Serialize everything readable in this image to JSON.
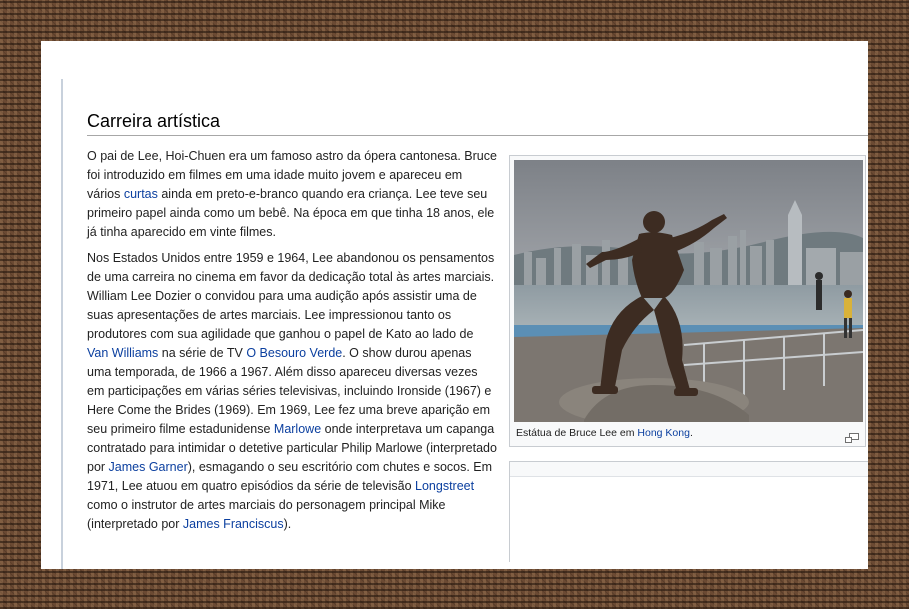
{
  "section": {
    "title": "Carreira artística"
  },
  "paragraph1": {
    "t1": "O pai de Lee, Hoi-Chuen era um famoso astro da ópera cantonesa. Bruce foi introduzido em filmes em uma idade muito jovem e apareceu em vários ",
    "link_curtas": "curtas",
    "t2": " ainda em preto-e-branco quando era criança. Lee teve seu primeiro papel ainda como um bebê. Na época em que tinha 18 anos, ele já tinha aparecido em vinte filmes."
  },
  "paragraph2": {
    "t1": "Nos Estados Unidos entre 1959 e 1964, Lee abandonou os pensamentos de uma carreira no cinema em favor da dedicação total às artes marciais. William Lee Dozier o convidou para uma audição após assistir uma de suas apresentações de artes marciais. Lee impressionou tanto os produtores com sua agilidade que ganhou o papel de Kato ao lado de ",
    "link_van_williams": "Van Williams",
    "t2": " na série de TV ",
    "link_besouro_verde": "O Besouro Verde",
    "t3": ". O show durou apenas uma temporada, de 1966 a 1967. Além disso apareceu diversas vezes em participações em várias séries televisivas, incluindo Ironside (1967) e Here Come the Brides (1969). Em 1969, Lee fez uma breve aparição em seu primeiro filme estadunidense ",
    "link_marlowe": "Marlowe",
    "t4": " onde interpretava um capanga contratado para intimidar o detetive particular Philip Marlowe (interpretado por ",
    "link_james_garner": "James Garner",
    "t5": "), esmagando o seu escritório com chutes e socos. Em 1971, Lee atuou em quatro episódios da série de televisão ",
    "link_longstreet": "Longstreet",
    "t6": " como o instrutor de artes marciais do personagem principal Mike (interpretado por ",
    "link_james_franciscus": "James Franciscus",
    "t7": ")."
  },
  "thumbnail": {
    "caption_text": "Estátua de Bruce Lee em ",
    "caption_link": "Hong Kong",
    "caption_end": ".",
    "icon": "magnify-icon"
  },
  "colors": {
    "link": "#0b3f9f",
    "text": "#222222",
    "rule": "#a7a7a7",
    "frame": "#6b4a33"
  }
}
